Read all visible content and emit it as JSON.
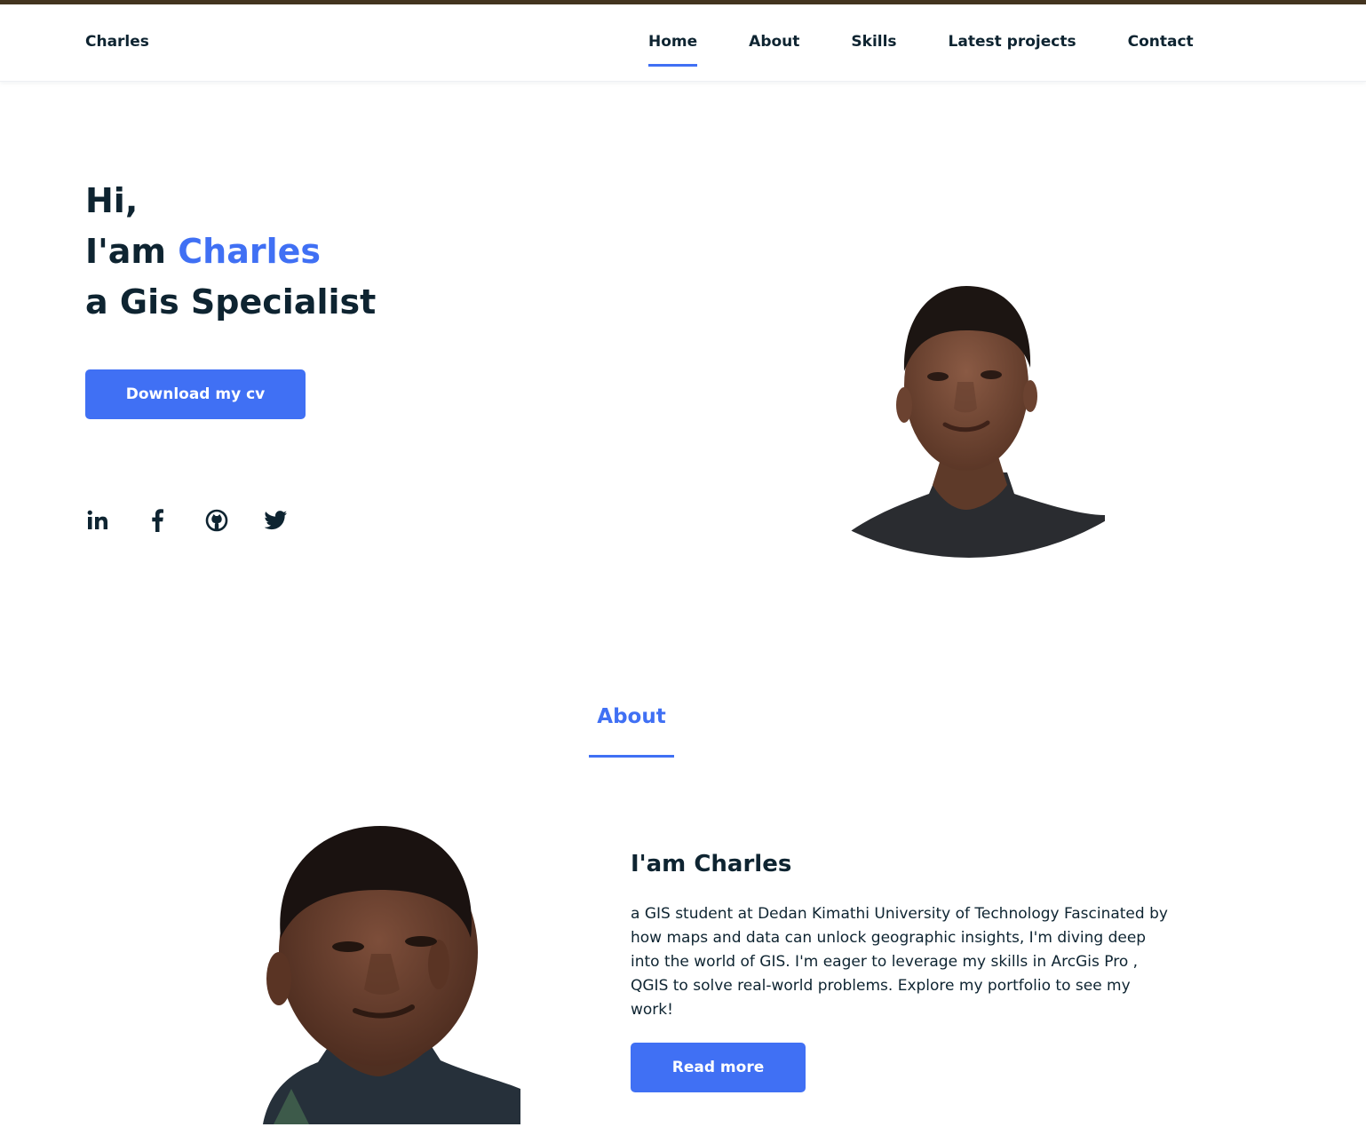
{
  "header": {
    "logo": "Charles",
    "nav": [
      {
        "label": "Home",
        "active": true
      },
      {
        "label": "About",
        "active": false
      },
      {
        "label": "Skills",
        "active": false
      },
      {
        "label": "Latest projects",
        "active": false
      },
      {
        "label": "Contact",
        "active": false
      }
    ]
  },
  "hero": {
    "line1": "Hi,",
    "line2_prefix": "I'am ",
    "line2_name": "Charles",
    "line3": "a Gis Specialist",
    "cv_button": "Download my cv",
    "socials": [
      "linkedin-icon",
      "facebook-icon",
      "github-icon",
      "twitter-icon"
    ]
  },
  "about": {
    "section_title": "About",
    "heading": "I'am Charles",
    "text": "a GIS student at Dedan Kimathi University of Technology Fascinated by how maps and data can unlock geographic insights, I'm diving deep into the world of GIS. I'm eager to leverage my skills in ArcGis Pro , QGIS to solve real-world problems. Explore my portfolio to see my work!",
    "read_more": "Read more"
  },
  "colors": {
    "accent": "#4070f4",
    "text": "#0e2431",
    "top_strip": "#43341f"
  }
}
